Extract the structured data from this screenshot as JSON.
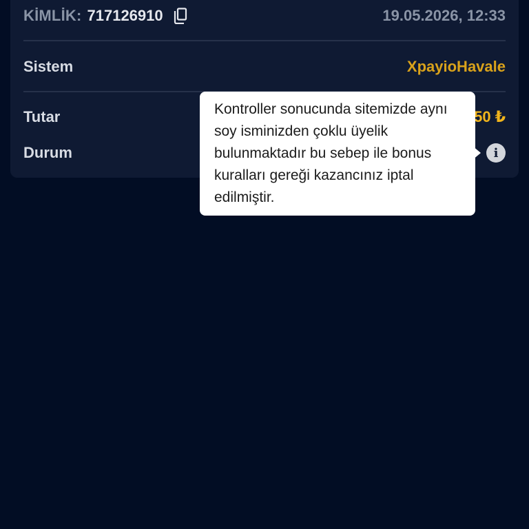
{
  "transaction": {
    "id_label": "KİMLİK:",
    "id_value": "717126910",
    "date": "19.05.2026, 12:33",
    "system_label": "Sistem",
    "system_value": "XpayioHavale",
    "amount_label": "Tutar",
    "amount_value_visible": "50 ₺",
    "status_label": "Durum"
  },
  "tooltip": {
    "text": "Kontroller sonucunda sitemizde aynı soy isminizden çoklu üyelik bulunmaktadır bu sebep ile bonus kuralları gereği kazancınız iptal edilmiştir."
  },
  "icons": {
    "copy": "copy-icon",
    "info": "info-icon"
  },
  "colors": {
    "background": "#020d24",
    "card": "#0f1a33",
    "accent_system": "#d9a21b",
    "accent_amount": "#f0b41c"
  }
}
